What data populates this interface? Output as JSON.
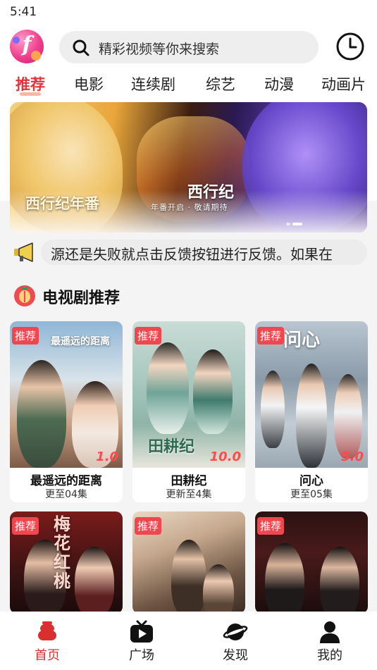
{
  "status_bar": {
    "time": "5:41"
  },
  "header": {
    "logo_letter": "f",
    "search_placeholder": "精彩视频等你来搜索",
    "history_icon": "clock-icon",
    "search_icon": "search-icon"
  },
  "tabs": [
    {
      "label": "推荐",
      "active": true
    },
    {
      "label": "电影"
    },
    {
      "label": "连续剧"
    },
    {
      "label": "综艺"
    },
    {
      "label": "动漫"
    },
    {
      "label": "动画片"
    }
  ],
  "banner": {
    "caption": "西行纪年番",
    "logo_title": "西行纪",
    "logo_sub": "年番开启 · 敬请期待",
    "slide_count": 2,
    "active_slide": 2
  },
  "notice": {
    "icon": "megaphone-icon",
    "text": "源还是失败就点击反馈按钮进行反馈。如果在"
  },
  "section": {
    "icon": "tomato-icon",
    "title": "电视剧推荐"
  },
  "cards": [
    {
      "badge": "推荐",
      "title": "最遥远的距离",
      "episode": "更至04集",
      "rating": "1.0",
      "poster_text": "最遥远的距离"
    },
    {
      "badge": "推荐",
      "title": "田耕纪",
      "episode": "更新至4集",
      "rating": "10.0",
      "poster_text": "田耕纪"
    },
    {
      "badge": "推荐",
      "title": "问心",
      "episode": "更至05集",
      "rating": "5.0",
      "poster_text": "问心"
    }
  ],
  "cards_row2": [
    {
      "badge": "推荐",
      "poster_text": "梅花红桃"
    },
    {
      "badge": "推荐"
    },
    {
      "badge": "推荐"
    }
  ],
  "bottom_nav": [
    {
      "label": "首页",
      "icon": "home-hat-icon",
      "active": true,
      "color": "#d9302f"
    },
    {
      "label": "广场",
      "icon": "tv-play-icon"
    },
    {
      "label": "发现",
      "icon": "planet-icon"
    },
    {
      "label": "我的",
      "icon": "user-icon"
    }
  ],
  "colors": {
    "accent": "#e0353b",
    "badge": "#f0474f",
    "rating": "#ff4b4b"
  }
}
